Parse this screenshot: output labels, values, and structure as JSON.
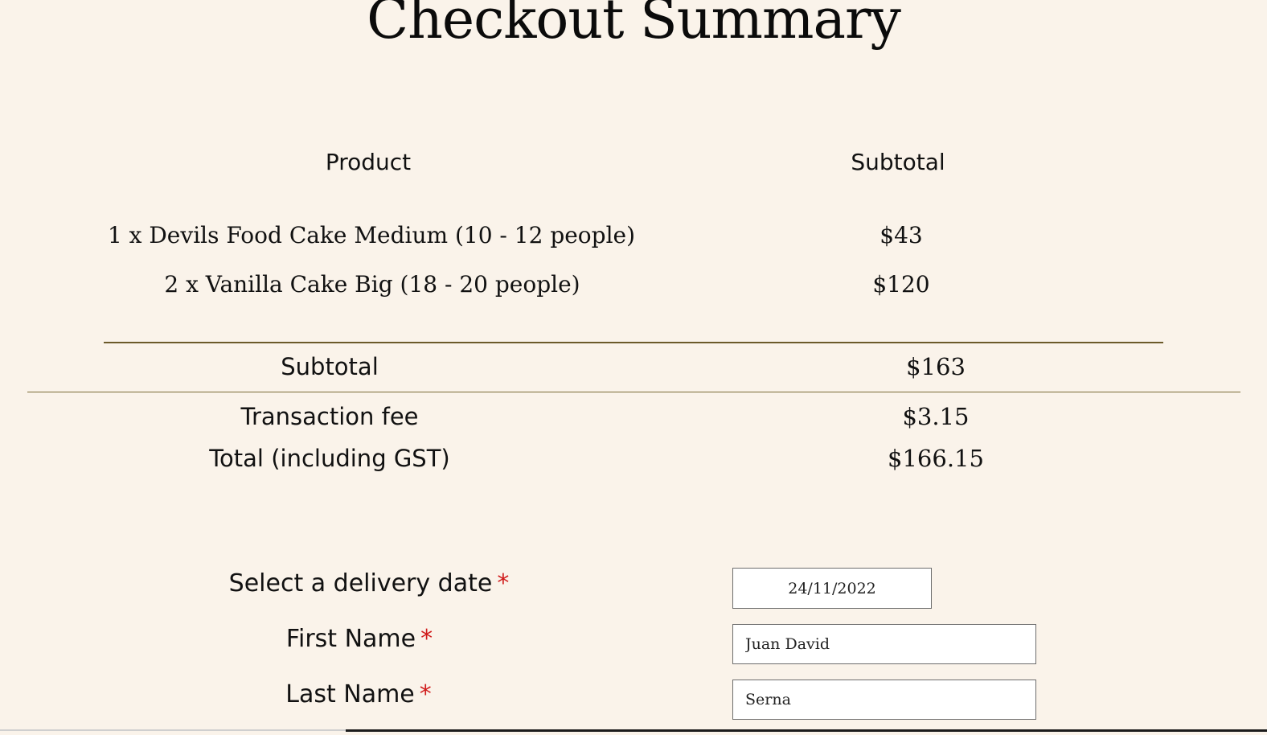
{
  "page": {
    "title": "Checkout Summary"
  },
  "table": {
    "headers": {
      "product": "Product",
      "subtotal": "Subtotal"
    },
    "items": [
      {
        "description": "1 x Devils Food Cake Medium (10 - 12 people)",
        "price": "$43"
      },
      {
        "description": "2 x Vanilla Cake Big (18 - 20 people)",
        "price": "$120"
      }
    ]
  },
  "summary": {
    "subtotal_label": "Subtotal",
    "subtotal_value": "$163",
    "fee_label": "Transaction fee",
    "fee_value": "$3.15",
    "total_label": "Total (including GST)",
    "total_value": "$166.15"
  },
  "form": {
    "delivery_date_label": "Select a delivery date",
    "delivery_date_value": "24/11/2022",
    "first_name_label": "First Name",
    "first_name_value": "Juan David",
    "last_name_label": "Last Name",
    "last_name_value": "Serna",
    "required_marker": "*"
  },
  "colors": {
    "background": "#faf3ea",
    "divider": "#6b5a2a",
    "required": "#d01c1c"
  }
}
